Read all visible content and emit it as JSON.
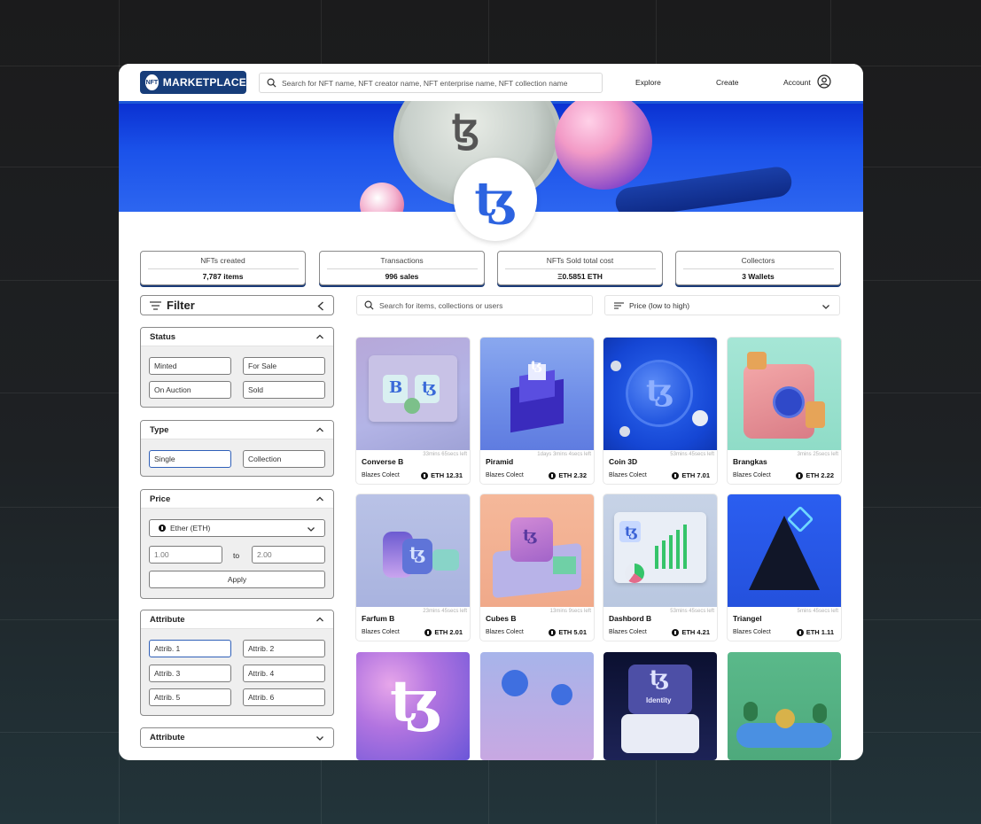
{
  "header": {
    "logo_badge": "NFT",
    "logo_text": "MARKETPLACE",
    "search_placeholder": "Search for NFT name, NFT creator name, NFT enterprise name, NFT collection name",
    "nav": [
      "Explore",
      "Create",
      "Account"
    ]
  },
  "banner": {
    "profile_glyph": "ꜩ"
  },
  "stats": [
    {
      "label": "NFTs created",
      "value": "7,787 items"
    },
    {
      "label": "Transactions",
      "value": "996 sales"
    },
    {
      "label": "NFTs Sold total cost",
      "value": "Ξ0.5851 ETH"
    },
    {
      "label": "Collectors",
      "value": "3 Wallets"
    }
  ],
  "filter": {
    "title": "Filter",
    "status": {
      "title": "Status",
      "options": [
        "Minted",
        "For Sale",
        "On Auction",
        "Sold"
      ]
    },
    "type": {
      "title": "Type",
      "options": [
        "Single",
        "Collection"
      ]
    },
    "price": {
      "title": "Price",
      "currency": "Ether (ETH)",
      "min": "1.00",
      "to": "to",
      "max": "2.00",
      "apply": "Apply"
    },
    "attribute": {
      "title": "Attribute",
      "options": [
        "Attrib. 1",
        "Attrib. 2",
        "Attrib. 3",
        "Attrib. 4",
        "Attrib. 5",
        "Attrib. 6"
      ]
    },
    "attribute2": {
      "title": "Attribute"
    }
  },
  "grid": {
    "search_placeholder": "Search for items, collections or users",
    "sort_label": "Price (low to high)",
    "cards": [
      {
        "name": "Converse B",
        "time": "33mins 65secs left",
        "creator": "Blazes Colect",
        "price": "ETH 12.31"
      },
      {
        "name": "Piramid",
        "time": "1days 3mins 4secs left",
        "creator": "Blazes Colect",
        "price": "ETH 2.32"
      },
      {
        "name": "Coin 3D",
        "time": "53mins 45secs left",
        "creator": "Blazes Colect",
        "price": "ETH 7.01"
      },
      {
        "name": "Brangkas",
        "time": "3mins 25secs left",
        "creator": "Blazes Colect",
        "price": "ETH 2.22"
      },
      {
        "name": "Farfum B",
        "time": "23mins 45secs left",
        "creator": "Blazes Colect",
        "price": "ETH 2.01"
      },
      {
        "name": "Cubes B",
        "time": "13mins 9secs left",
        "creator": "Blazes Colect",
        "price": "ETH 5.01"
      },
      {
        "name": "Dashbord B",
        "time": "53mins 45secs left",
        "creator": "Blazes Colect",
        "price": "ETH 4.21"
      },
      {
        "name": "Triangel",
        "time": "5mins 45secs left",
        "creator": "Blazes Colect",
        "price": "ETH 1.11"
      }
    ],
    "row3_labels": {
      "identity_text": "Identity"
    }
  },
  "colors": {
    "brand": "#173d7a",
    "banner": "#1b52ea",
    "accent_blue": "#2c63e0"
  },
  "icons": [
    "search-icon",
    "filter-lines-icon",
    "chevron-left-icon",
    "chevron-up-icon",
    "chevron-down-icon",
    "account-icon",
    "sort-icon",
    "eth-icon"
  ]
}
